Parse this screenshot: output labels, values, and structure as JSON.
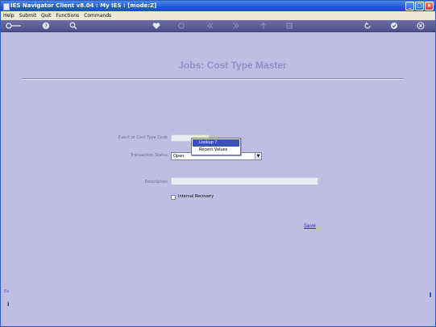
{
  "window": {
    "title": "IES Navigator Client v8.04 : My IES :      [mode:Z]",
    "controls": {
      "minimize": "_",
      "maximize": "□",
      "close": "×"
    }
  },
  "menu": [
    "Help",
    "Submit",
    "Quit",
    "Functions",
    "Commands"
  ],
  "toolbar": {
    "icons": [
      "key-icon",
      "help-icon",
      "search-icon",
      "heart-icon",
      "refresh-icon",
      "rewind-icon",
      "fast-forward-icon",
      "upload-icon",
      "list-icon",
      "back-icon",
      "check-icon",
      "close-icon"
    ]
  },
  "page": {
    "title": "Jobs: Cost Type Master",
    "form": {
      "cost_type_code_label": "Event or Cost Type Code",
      "transaction_status_label": "Transaction Status",
      "transaction_status_value": "Open",
      "description_label": "Description",
      "internal_recovery_label": "Internal Recovery",
      "save_label": "Save"
    },
    "popup": {
      "items": [
        "Lookup ?",
        "Recent Values"
      ]
    },
    "left_marks": {
      "top": "Ex",
      "bottom": "i"
    }
  }
}
